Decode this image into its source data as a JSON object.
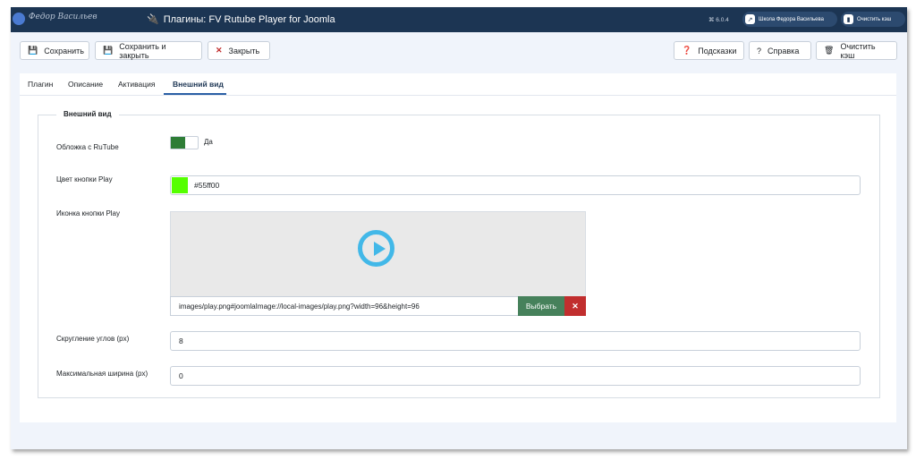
{
  "header": {
    "logo_text": "Федор Васильев",
    "title": "Плагины: FV Rutube Player for Joomla",
    "version": "⌘ 6.0.4",
    "site_button": "Школа Федора Васильева",
    "cache_button": "Очистить кэш"
  },
  "toolbar": {
    "save": "Сохранить",
    "save_close": "Сохранить и закрыть",
    "close": "Закрыть",
    "tips": "Подсказки",
    "help": "Справка",
    "clear_cache": "Очистить кэш"
  },
  "tabs": [
    "Плагин",
    "Описание",
    "Активация",
    "Внешний вид"
  ],
  "active_tab": "Внешний вид",
  "form": {
    "legend": "Внешний вид",
    "cover_label": "Обложка с RuTube",
    "cover_value": "Да",
    "play_color_label": "Цвет кнопки Play",
    "play_color_value": "#55ff00",
    "play_icon_label": "Иконка кнопки Play",
    "play_icon_path": "images/play.png#joomlaImage://local-images/play.png?width=96&height=96",
    "select_button": "Выбрать",
    "clear_button": "✕",
    "radius_label": "Скругление углов (px)",
    "radius_value": "8",
    "max_width_label": "Максимальная ширина (px)",
    "max_width_value": "0"
  },
  "colors": {
    "header_bg": "#1c3553",
    "accent": "#2a5fa5",
    "toggle_on": "#2e7d36",
    "select_btn": "#46815b",
    "clear_btn": "#c12e2e",
    "play_icon": "#42b8e8",
    "play_color_swatch": "#55ff00"
  },
  "icons": {
    "save": "floppy-icon",
    "close": "x-icon",
    "tips": "question-circle-icon",
    "help": "question-icon",
    "clear_cache": "trash-icon",
    "title": "plug-icon",
    "site": "external-link-icon"
  }
}
